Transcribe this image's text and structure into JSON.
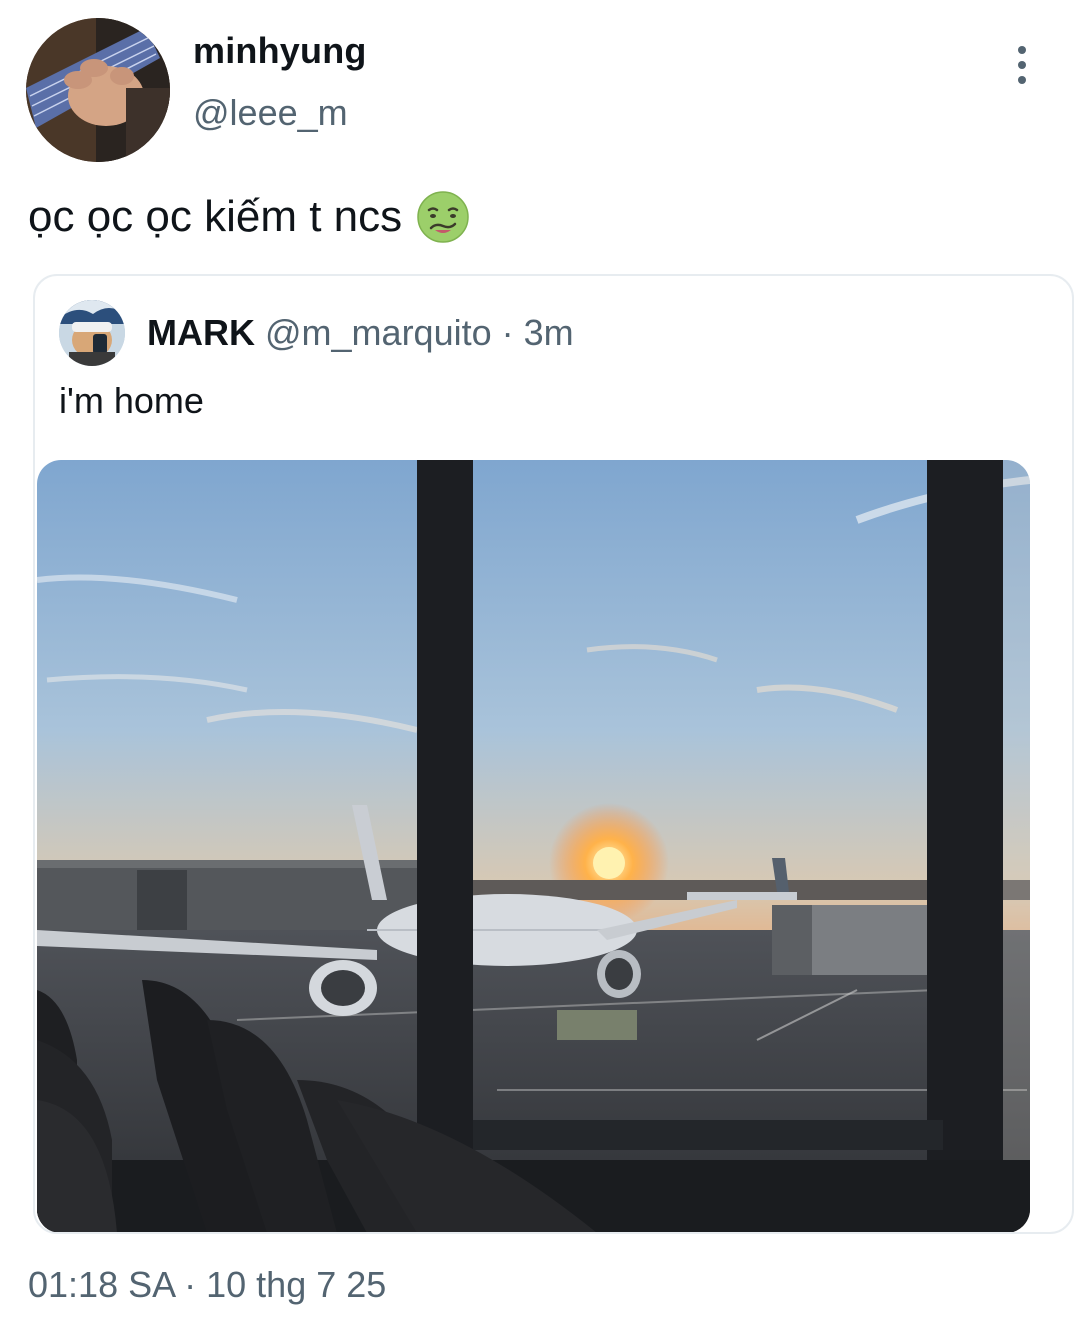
{
  "tweet": {
    "author": {
      "display_name": "minhyung",
      "handle": "@leee_m"
    },
    "text": "ọc ọc ọc kiếm t ncs",
    "emoji": "nauseated-face-emoji",
    "timestamp": "01:18 SA · 10 thg 7 25"
  },
  "quoted_tweet": {
    "author": {
      "display_name": "MARK",
      "handle": "@m_marquito"
    },
    "separator": "·",
    "time": "3m",
    "text": "i'm home",
    "media": "airport-sunset-photo"
  },
  "icons": {
    "more": "more-vertical-icon"
  },
  "colors": {
    "text_primary": "#0f1419",
    "text_secondary": "#536471",
    "border": "#e7ecf0"
  }
}
